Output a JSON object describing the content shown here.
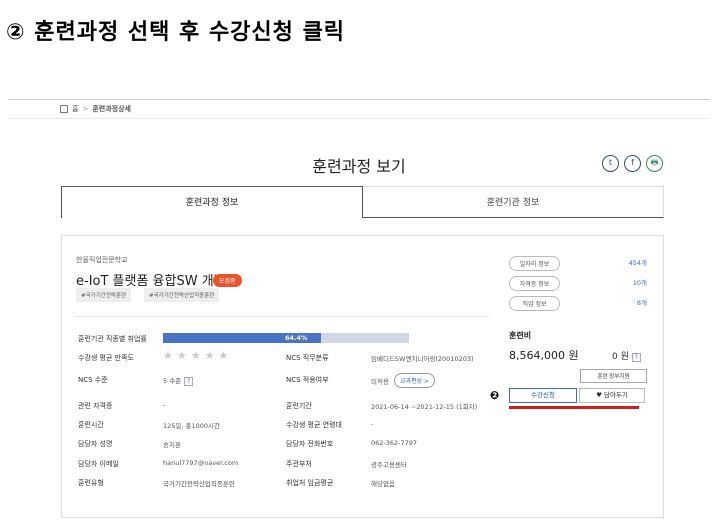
{
  "instruction": "② 훈련과정 선택 후 수강신청 클릭",
  "breadcrumb": {
    "home": "홈",
    "sep": ">",
    "current": "훈련과정상세"
  },
  "page_title": "훈련과정 보기",
  "share": {
    "twitter": "t",
    "facebook": "f",
    "print": "🖶"
  },
  "tabs": [
    {
      "label": "훈련과정 정보"
    },
    {
      "label": "훈련기관 정보"
    }
  ],
  "course": {
    "org": "한울직업전문학교",
    "title": "e-IoT 플랫폼 융합SW 개발",
    "badge": "모집중",
    "tags": [
      "#국가기간전략훈련",
      "#국가기간전략산업직종훈련"
    ]
  },
  "employment": {
    "label": "훈련기관 직종별 취업률",
    "value_text": "64.4%",
    "value": 0.644
  },
  "details": {
    "satisfaction_label": "수강생 평균 만족도",
    "ncs_class_label": "NCS 직무분류",
    "ncs_class_value": "임베디드SW엔지니어링(20010203)",
    "ncs_level_label": "NCS 수준",
    "ncs_level_value": "5 수준",
    "ncs_applied_label": "NCS 적용여부",
    "ncs_applied_value": "미적용",
    "ncs_applied_btn": "교과편성 >",
    "cert_label": "관련 자격증",
    "cert_value": "-",
    "period_label": "훈련기간",
    "period_value": "2021-06-14 ~2021-12-15 (1회차)",
    "time_label": "훈련시간",
    "time_value": "125일, 총1000시간",
    "age_label": "수강생 평균 연령대",
    "age_value": "-",
    "manager_label": "담당자 성명",
    "manager_value": "송지훈",
    "phone_label": "담당자 전화번호",
    "phone_value": "062-362-7797",
    "email_label": "담당자 이메일",
    "email_value": "hanul7797@naver.com",
    "dept_label": "주관부처",
    "dept_value": "광주고용센터",
    "type_label": "훈련유형",
    "type_value": "국가기간전략산업직종훈련",
    "wage_label": "취업처 임금평균",
    "wage_value": "해당없음",
    "q": "?"
  },
  "side": {
    "job_info": "일자리 정보",
    "job_count": "454개",
    "cert_info": "자격증 정보",
    "cert_count": "10개",
    "career_info": "직업 정보",
    "career_count": "8개",
    "fee_label": "훈련비",
    "fee_value": "8,564,000 원",
    "self_pay": "0 원",
    "support_btn": "훈련 장부지원",
    "marker": "❷",
    "apply_btn": "수강신청",
    "save_btn": "♥ 담아두기"
  },
  "colors": {
    "accent": "#3a6ec3",
    "badge": "#e8542b",
    "underline": "#d31d1d"
  }
}
